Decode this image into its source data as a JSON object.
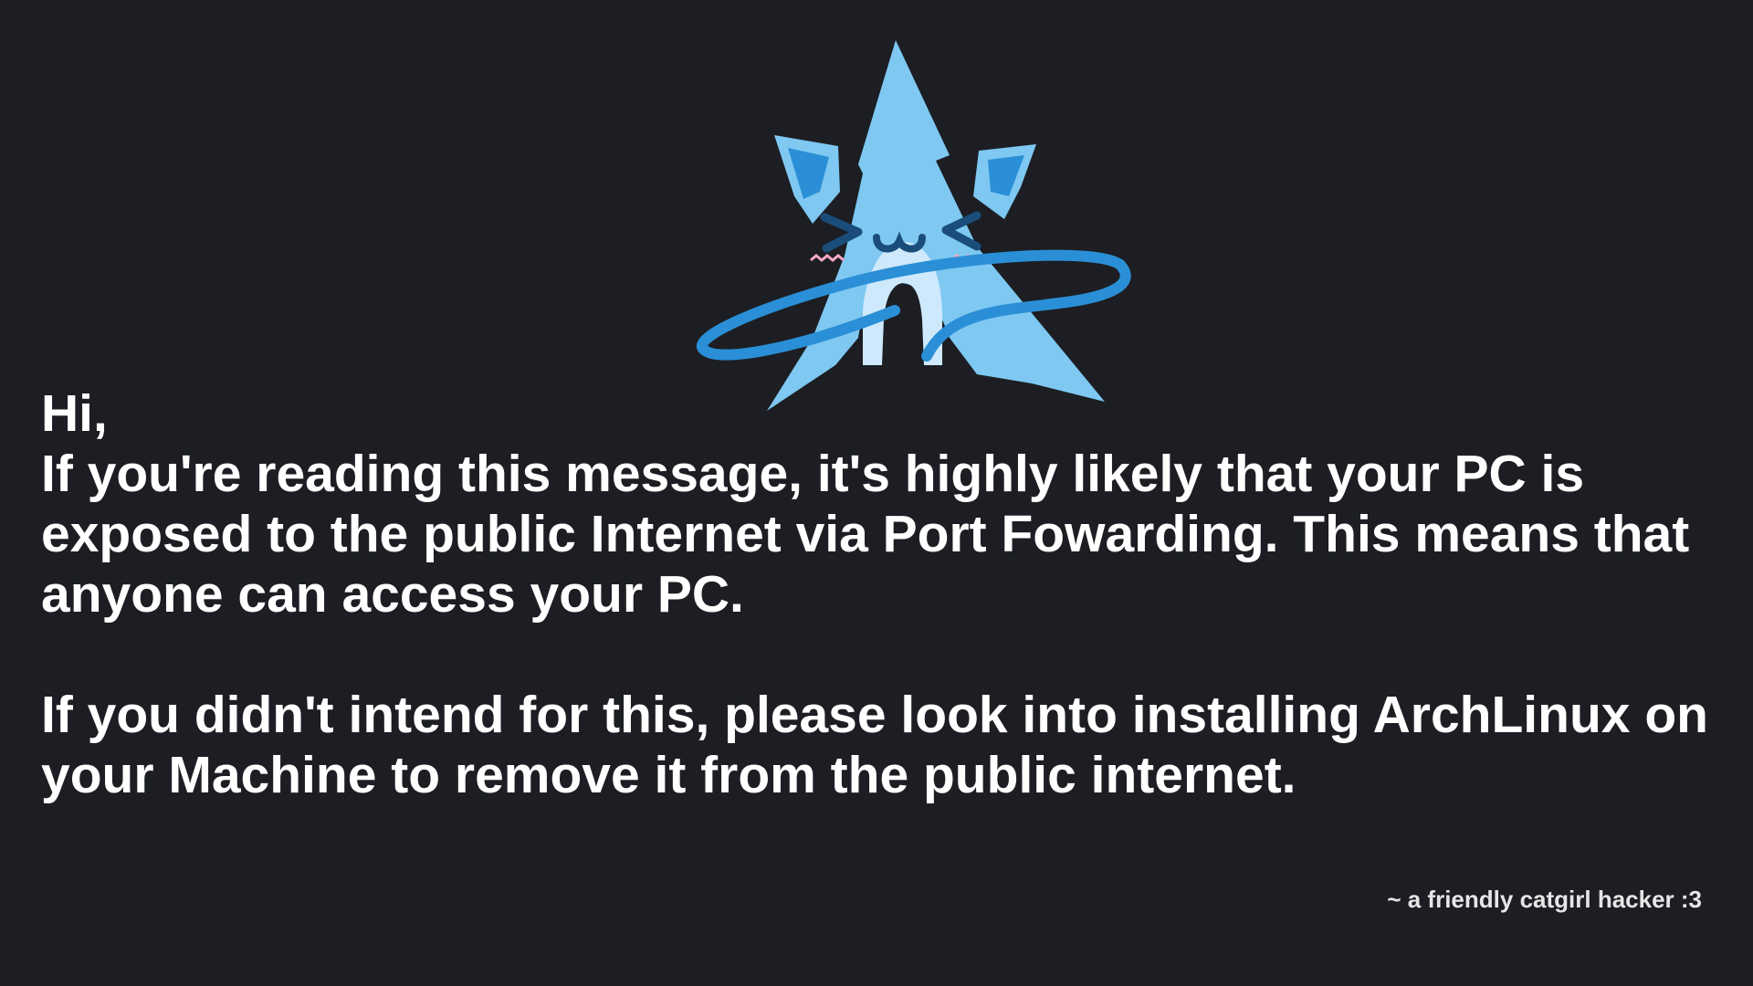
{
  "message": {
    "greeting": "Hi,",
    "paragraph1": "If you're reading this message, it's highly likely that your PC is exposed to the public Internet via Port Fowarding. This means that anyone can access your PC.",
    "paragraph2": "If you didn't intend for this, please look into installing ArchLinux on your Machine to remove it from the public internet."
  },
  "signature": "~ a friendly catgirl hacker :3",
  "colors": {
    "background": "#1c1e23",
    "text": "#ffffff",
    "mascot_light": "#7ec8f2",
    "mascot_dark": "#2a8fd6",
    "mascot_pale": "#cde9fb"
  },
  "icons": {
    "mascot": "arch-catgirl-mascot-icon"
  }
}
